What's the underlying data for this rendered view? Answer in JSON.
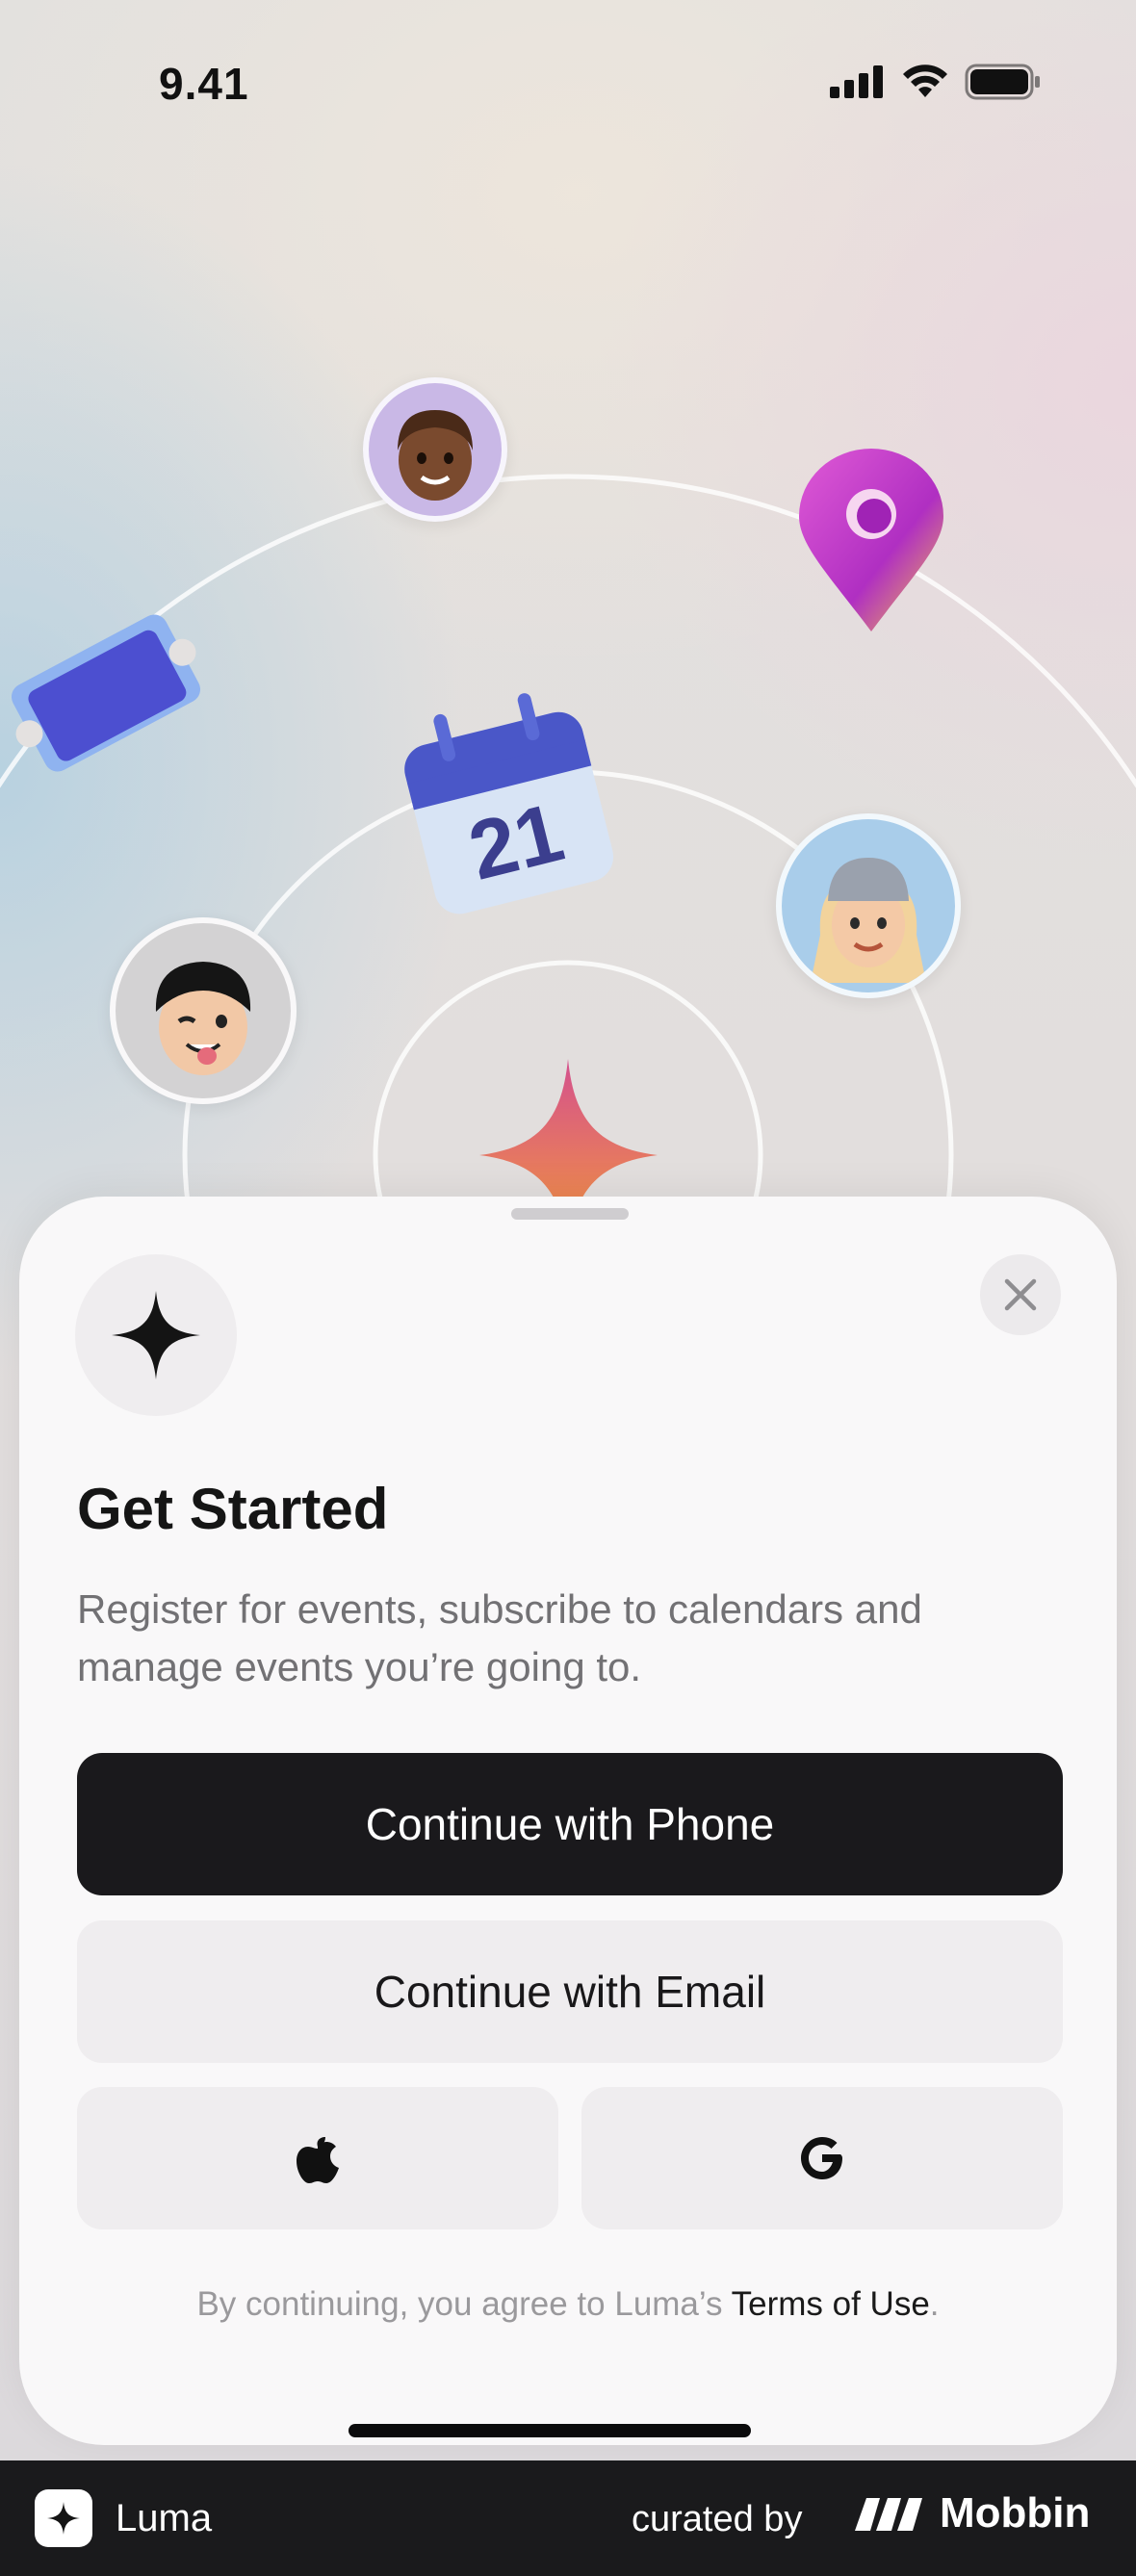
{
  "status_bar": {
    "time": "9.41",
    "icons": [
      "cellular-signal-icon",
      "wifi-icon",
      "battery-icon"
    ]
  },
  "hero": {
    "calendar_day": "21",
    "illustrations": [
      "avatar-brown-hair",
      "location-pin-icon",
      "ticket-icon",
      "calendar-icon",
      "avatar-beanie",
      "avatar-winking",
      "sparkle-star-icon"
    ]
  },
  "sheet": {
    "app_badge_icon": "sparkle-icon",
    "close_icon": "close-icon",
    "title": "Get Started",
    "subtitle": "Register for events, subscribe to calendars and manage events you’re going to.",
    "buttons": {
      "phone": "Continue with Phone",
      "email": "Continue with Email",
      "apple_icon": "apple-icon",
      "google_icon": "google-icon"
    },
    "terms": {
      "prefix": "By continuing, you agree to Luma’s ",
      "link": "Terms of Use",
      "suffix": "."
    }
  },
  "footer": {
    "app_name": "Luma",
    "curated_by": "curated by",
    "brand": "Mobbin"
  },
  "colors": {
    "primary_button": "#1a191c",
    "secondary_button": "#efedef",
    "sheet_background": "#f9f8f9",
    "footer_background": "#1a1a1c",
    "star_gradient_top": "#d4508e",
    "star_gradient_bottom": "#f59a3a"
  }
}
